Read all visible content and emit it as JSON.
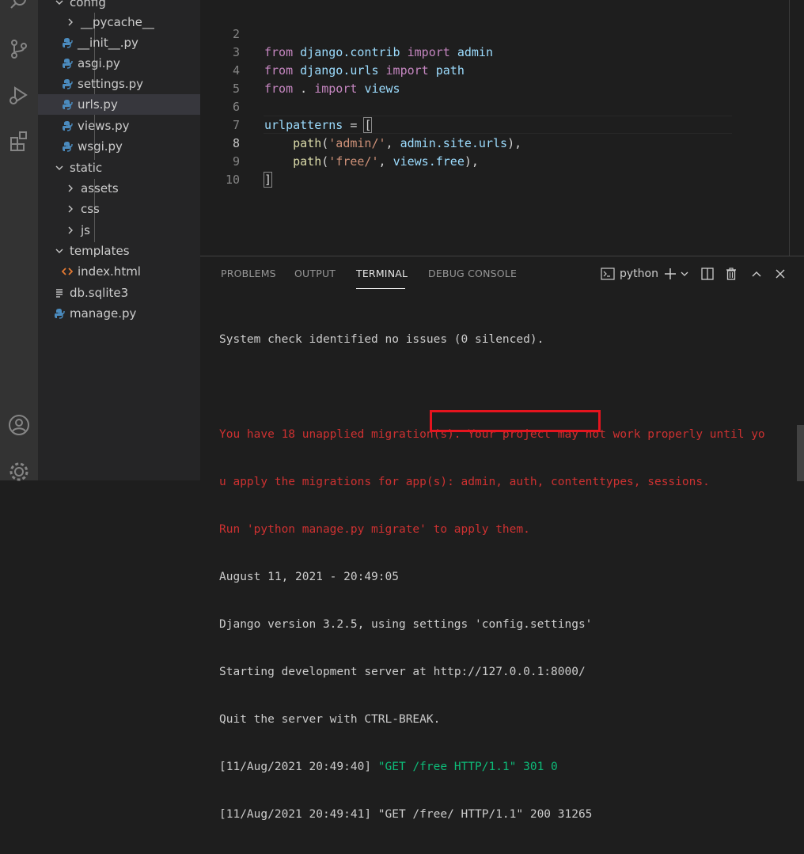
{
  "explorer": {
    "items": [
      {
        "label": "config",
        "type": "folder-open"
      },
      {
        "label": "__pycache__",
        "type": "folder-closed"
      },
      {
        "label": "__init__.py",
        "type": "python"
      },
      {
        "label": "asgi.py",
        "type": "python"
      },
      {
        "label": "settings.py",
        "type": "python"
      },
      {
        "label": "urls.py",
        "type": "python",
        "selected": true
      },
      {
        "label": "views.py",
        "type": "python"
      },
      {
        "label": "wsgi.py",
        "type": "python"
      },
      {
        "label": "static",
        "type": "folder-open"
      },
      {
        "label": "assets",
        "type": "folder-closed"
      },
      {
        "label": "css",
        "type": "folder-closed"
      },
      {
        "label": "js",
        "type": "folder-closed"
      },
      {
        "label": "templates",
        "type": "folder-open"
      },
      {
        "label": "index.html",
        "type": "html"
      },
      {
        "label": "db.sqlite3",
        "type": "database"
      },
      {
        "label": "manage.py",
        "type": "python"
      }
    ]
  },
  "editor": {
    "line_numbers": [
      "2",
      "3",
      "4",
      "5",
      "6",
      "7",
      "8",
      "9",
      "10"
    ],
    "active_line": "8",
    "lines": [
      {
        "from": "from",
        "mod": "django.contrib",
        "imp": "import",
        "name": "admin"
      },
      {
        "from": "from",
        "mod": "django.urls",
        "imp": "import",
        "name": "path"
      },
      {
        "from": "from",
        "mod": ".",
        "imp": "import",
        "name": "views"
      }
    ],
    "urlpatterns": "urlpatterns",
    "eq": " = ",
    "open_bracket": "[",
    "path_fn": "path",
    "admin_str": "'admin/'",
    "admin_target": "admin.site.urls",
    "free_str": "'free/'",
    "free_target": "views.free",
    "close_bracket": "]"
  },
  "panel": {
    "tabs": [
      "PROBLEMS",
      "OUTPUT",
      "TERMINAL",
      "DEBUG CONSOLE"
    ],
    "active_tab": "TERMINAL",
    "terminal_name": "python",
    "icons": [
      "terminal-icon",
      "add-terminal-icon",
      "chevron-down-icon",
      "split-terminal-icon",
      "trash-icon",
      "maximize-panel-icon",
      "close-panel-icon"
    ]
  },
  "terminal": {
    "line_check": "System check identified no issues (0 silenced).",
    "warn1": "You have 18 unapplied migration(s). Your project may not work properly until yo",
    "warn2": "u apply the migrations for app(s): admin, auth, contenttypes, sessions.",
    "warn3": "Run 'python manage.py migrate' to apply them.",
    "date": "August 11, 2021 - 20:49:05",
    "version": "Django version 3.2.5, using settings 'config.settings'",
    "start_prefix": "Starting development server at ",
    "url": "http://127.0.0.1:8000/",
    "quit": "Quit the server with CTRL-BREAK.",
    "log1_time": "[11/Aug/2021 20:49:40] ",
    "log1_req": "\"GET /free HTTP/1.1\" 301 0",
    "log2": "[11/Aug/2021 20:49:41] \"GET /free/ HTTP/1.1\" 200 31265"
  },
  "colors": {
    "highlight_box": "#e5141e",
    "error_text": "#cd3131",
    "redirect_log": "#0dbc79"
  }
}
